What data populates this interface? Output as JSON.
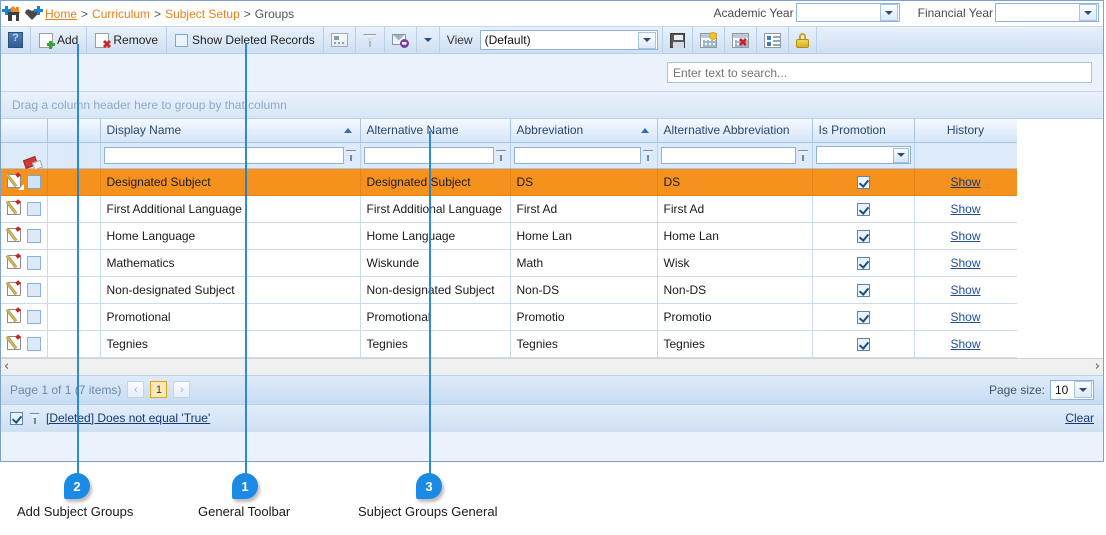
{
  "breadcrumb": {
    "home_icon": "house-icon",
    "favorite_icon": "heart-icon",
    "items": [
      {
        "label": "Home",
        "link": true
      },
      {
        "label": "Curriculum",
        "link": true
      },
      {
        "label": "Subject Setup",
        "link": true
      },
      {
        "label": "Groups",
        "link": false
      }
    ],
    "separator": ">"
  },
  "year_selectors": {
    "academic_label": "Academic Year",
    "academic_value": "",
    "financial_label": "Financial Year",
    "financial_value": ""
  },
  "toolbar": {
    "help_icon": "help-icon",
    "add_label": "Add",
    "add_icon": "page-add-icon",
    "remove_label": "Remove",
    "remove_icon": "page-delete-icon",
    "show_deleted_label": "Show Deleted Records",
    "show_deleted_checked": false,
    "card_view_icon": "card-view-icon",
    "filter_icon": "funnel-icon",
    "mail_icon": "mail-export-icon",
    "mail_dropdown_icon": "chevron-down-icon",
    "view_label": "View",
    "view_value": "(Default)",
    "save_icon": "save-icon",
    "save_view_icon": "save-view-icon",
    "delete_view_icon": "delete-view-icon",
    "layout_icon": "layout-icon",
    "lock_icon": "lock-icon"
  },
  "search": {
    "placeholder": "Enter text to search...",
    "value": ""
  },
  "group_panel": {
    "hint": "Drag a column header here to group by that column"
  },
  "grid": {
    "clear_filter_icon": "eraser-icon",
    "columns": [
      {
        "key": "edit",
        "label": "",
        "sort": ""
      },
      {
        "key": "sel",
        "label": "",
        "sort": ""
      },
      {
        "key": "display_name",
        "label": "Display Name",
        "sort": "asc"
      },
      {
        "key": "alternative_name",
        "label": "Alternative Name",
        "sort": ""
      },
      {
        "key": "abbreviation",
        "label": "Abbreviation",
        "sort": "asc"
      },
      {
        "key": "alternative_abbreviation",
        "label": "Alternative Abbreviation",
        "sort": ""
      },
      {
        "key": "is_promotion",
        "label": "Is Promotion",
        "sort": ""
      },
      {
        "key": "history",
        "label": "History",
        "sort": ""
      }
    ],
    "filter_row": {
      "display_name": "",
      "alternative_name": "",
      "abbreviation": "",
      "alternative_abbreviation": "",
      "is_promotion": ""
    },
    "history_link_label": "Show",
    "rows": [
      {
        "display_name": "Designated Subject",
        "alternative_name": "Designated Subject",
        "abbreviation": "DS",
        "alternative_abbreviation": "DS",
        "is_promotion": true,
        "history": "Show",
        "selected": true
      },
      {
        "display_name": "First Additional Language",
        "alternative_name": "First Additional Language",
        "abbreviation": "First Ad",
        "alternative_abbreviation": "First Ad",
        "is_promotion": true,
        "history": "Show",
        "selected": false
      },
      {
        "display_name": "Home Language",
        "alternative_name": "Home Language",
        "abbreviation": "Home Lan",
        "alternative_abbreviation": "Home Lan",
        "is_promotion": true,
        "history": "Show",
        "selected": false
      },
      {
        "display_name": "Mathematics",
        "alternative_name": "Wiskunde",
        "abbreviation": "Math",
        "alternative_abbreviation": "Wisk",
        "is_promotion": true,
        "history": "Show",
        "selected": false
      },
      {
        "display_name": "Non-designated Subject",
        "alternative_name": "Non-designated Subject",
        "abbreviation": "Non-DS",
        "alternative_abbreviation": "Non-DS",
        "is_promotion": true,
        "history": "Show",
        "selected": false
      },
      {
        "display_name": "Promotional",
        "alternative_name": "Promotional",
        "abbreviation": "Promotio",
        "alternative_abbreviation": "Promotio",
        "is_promotion": true,
        "history": "Show",
        "selected": false
      },
      {
        "display_name": "Tegnies",
        "alternative_name": "Tegnies",
        "abbreviation": "Tegnies",
        "alternative_abbreviation": "Tegnies",
        "is_promotion": true,
        "history": "Show",
        "selected": false
      }
    ]
  },
  "hscroll": {
    "left_arrow": "‹",
    "right_arrow": "›"
  },
  "pager": {
    "summary": "Page 1 of 1 (7 items)",
    "prev_label": "‹",
    "current_page": "1",
    "next_label": "›",
    "page_size_label": "Page size:",
    "page_size_value": "10"
  },
  "filter_bar": {
    "enabled": true,
    "filter_icon": "funnel-icon",
    "expression": "[Deleted] Does not equal 'True'",
    "clear_label": "Clear"
  },
  "callouts": [
    {
      "number": "2",
      "label": "Add Subject Groups"
    },
    {
      "number": "1",
      "label": "General Toolbar"
    },
    {
      "number": "3",
      "label": "Subject Groups General"
    }
  ],
  "colors": {
    "accent_orange": "#f5921e",
    "link_orange": "#e8801b",
    "callout_blue": "#1a8ae5",
    "frame_blue": "#7da2ce"
  }
}
